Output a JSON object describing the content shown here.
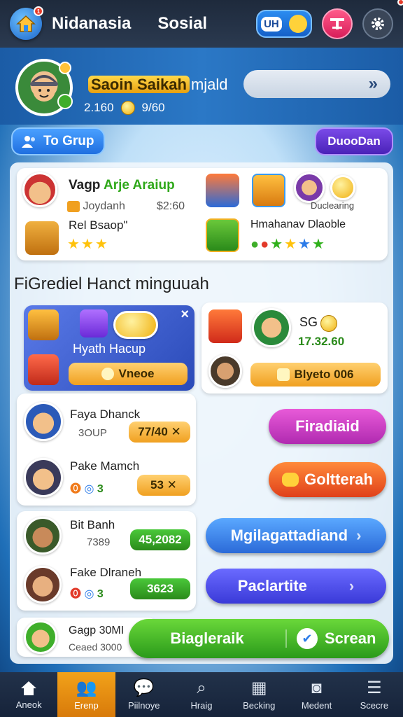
{
  "topbar": {
    "title": "Nidanasia",
    "subtitle": "Sosial",
    "pill_label": "UH",
    "home_icon": "house-icon",
    "notif_count": "1"
  },
  "profile": {
    "name_highlight": "Saoin Saikah",
    "name_rest": "mjald",
    "stat_1": "2.160",
    "stat_2": "9/60",
    "search_arrow": "»"
  },
  "buttons": {
    "group": "To Grup",
    "duo": "DuooDan"
  },
  "top_card": {
    "row1_title_a": "Vagp ",
    "row1_title_b": "Arje Araiup",
    "row1_sub": "Joydanh",
    "row1_price": "$2:60",
    "row2_title": "Rel Bsaop\"",
    "right_label_1": "Duclearing",
    "right_label_2": "Hmahanav Dlaoble"
  },
  "section_title": "FiGrediel Hanct minguuah",
  "promo": {
    "title": "Hyath Hacup",
    "button": "Vneoe",
    "close": "×"
  },
  "reward_card": {
    "label": "SG",
    "value": "17.32.60",
    "chip": "Blyeto 006"
  },
  "players": [
    {
      "name": "Faya Dhanck",
      "sub": "3OUP",
      "chip": "77/40 ✕"
    },
    {
      "name": "Pake Mamch",
      "sub": "3",
      "chip": "53 ✕"
    },
    {
      "name": "Bit Banh",
      "sub": "7389",
      "chip": "45,2082"
    },
    {
      "name": "Fake Dlraneh",
      "sub": "3",
      "chip": "3623"
    }
  ],
  "actions": {
    "btn1": "Firadiaid",
    "btn2": "Goltterah",
    "btn3": "Mgilagattadiand",
    "btn4": "Paclartite"
  },
  "footer_row": {
    "name": "Gagp 30MI",
    "sub": "Ceaed 3000",
    "btn_left": "Biagleraik",
    "btn_right": "Screan"
  },
  "nav": [
    {
      "label": "Aneok",
      "icon": "home-icon"
    },
    {
      "label": "Erenp",
      "icon": "group-icon"
    },
    {
      "label": "Piilnoye",
      "icon": "chat-icon"
    },
    {
      "label": "Hraig",
      "icon": "search-icon"
    },
    {
      "label": "Becking",
      "icon": "calendar-icon"
    },
    {
      "label": "Medent",
      "icon": "camera-icon"
    },
    {
      "label": "Scecre",
      "icon": "menu-icon"
    }
  ],
  "colors": {
    "accent_orange": "#f2a21a",
    "green": "#3fae2a",
    "blue": "#2b7be8"
  }
}
